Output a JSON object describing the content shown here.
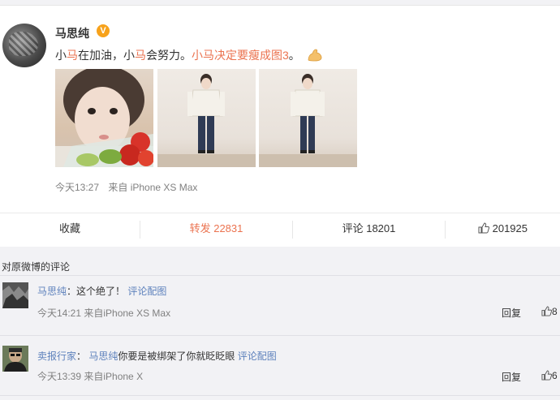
{
  "post": {
    "username": "马思纯",
    "verified_badge": "V",
    "text_segments": [
      "小",
      "马",
      "在加油，小",
      "马",
      "会努力。",
      "小马决定要瘦成图3",
      "。"
    ],
    "emoji": "flexed-biceps-icon",
    "time": "今天13:27",
    "source": "来自 iPhone XS Max",
    "photos": [
      {
        "desc": "selfie-with-salad-photo"
      },
      {
        "desc": "full-body-photo-1"
      },
      {
        "desc": "full-body-photo-2"
      }
    ]
  },
  "actions": {
    "collect": "收藏",
    "repost": "转发 22831",
    "comment": "评论 18201",
    "like": "201925"
  },
  "comments_header": "对原微博的评论",
  "comments": [
    {
      "user": "马思纯",
      "sep": "：",
      "text": "这个绝了！",
      "attachment": "评论配图",
      "time": "今天14:21 来自iPhone XS Max",
      "reply": "回复",
      "likes": "8"
    },
    {
      "user": "卖报行家",
      "sep": "：",
      "mention": "马思纯",
      "text": "你要是被绑架了你就眨眨眼",
      "attachment": "评论配图",
      "time": "今天13:39 来自iPhone X",
      "reply": "回复",
      "likes": "6"
    }
  ],
  "colors": {
    "accent": "#eb7350",
    "link": "#5d81bc",
    "meta": "#808080"
  }
}
